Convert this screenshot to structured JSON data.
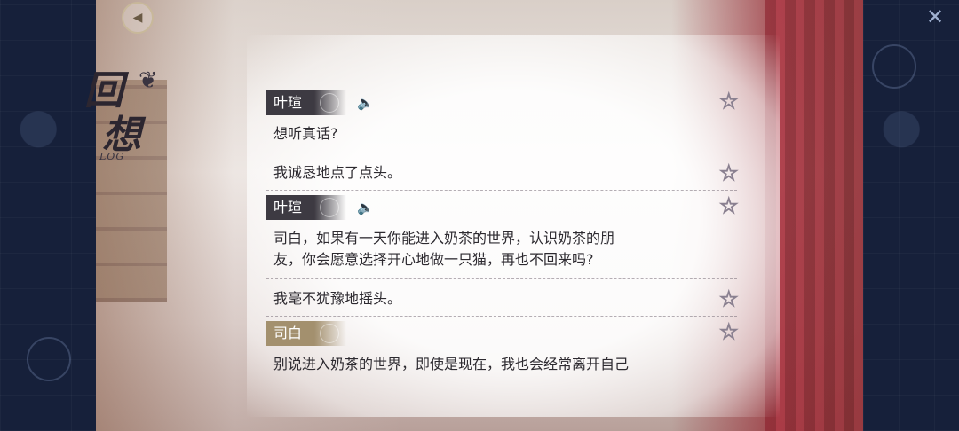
{
  "title": {
    "chars": [
      "回",
      "想"
    ],
    "sub": "LOG"
  },
  "controls": {
    "back_icon": "back-arrow-icon",
    "close_icon": "close-icon"
  },
  "entries": [
    {
      "speaker": "叶瑄",
      "tag_style": "dark",
      "voice": true,
      "lines": [
        "想听真话?"
      ]
    },
    {
      "speaker": "",
      "voice": false,
      "lines": [
        "我诚恳地点了点头。"
      ]
    },
    {
      "speaker": "叶瑄",
      "tag_style": "dark",
      "voice": true,
      "lines": [
        "司白，如果有一天你能进入奶茶的世界，认识奶茶的朋",
        "友，你会愿意选择开心地做一只猫，再也不回来吗?"
      ]
    },
    {
      "speaker": "",
      "voice": false,
      "lines": [
        "我毫不犹豫地摇头。"
      ]
    },
    {
      "speaker": "司白",
      "tag_style": "gold",
      "voice": false,
      "lines": [
        "别说进入奶茶的世界，即使是现在，我也会经常离开自己"
      ]
    }
  ]
}
